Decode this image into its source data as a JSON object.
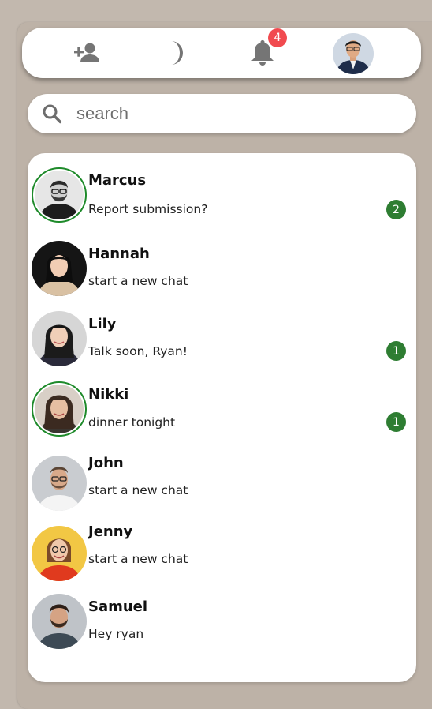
{
  "topbar": {
    "icons": [
      "add-person-icon",
      "moon-icon",
      "bell-icon"
    ],
    "notification_count": "4"
  },
  "search": {
    "placeholder": "search",
    "value": ""
  },
  "colors": {
    "background": "#c2b8ae",
    "notification_badge": "#f14a4f",
    "unread_badge": "#2e7d32",
    "online_ring": "#1e8a2a"
  },
  "contacts": [
    {
      "name": "Marcus",
      "message": "Report submission?",
      "unread": "2",
      "online": true
    },
    {
      "name": "Hannah",
      "message": "start a new chat",
      "unread": "",
      "online": false
    },
    {
      "name": "Lily",
      "message": "Talk soon, Ryan!",
      "unread": "1",
      "online": false
    },
    {
      "name": "Nikki",
      "message": "dinner tonight",
      "unread": "1",
      "online": true
    },
    {
      "name": "John",
      "message": "start a new chat",
      "unread": "",
      "online": false
    },
    {
      "name": "Jenny",
      "message": "start a new chat",
      "unread": "",
      "online": false
    },
    {
      "name": "Samuel",
      "message": "Hey ryan",
      "unread": "",
      "online": false
    }
  ]
}
